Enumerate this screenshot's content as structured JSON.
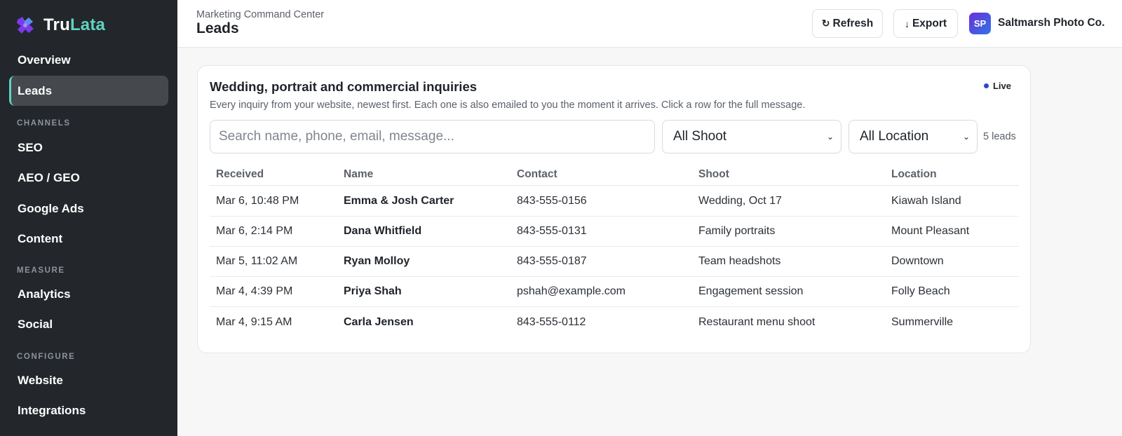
{
  "brand": {
    "name_part1": "Tru",
    "name_part2": "Lata",
    "accent_color": "#5fd3c0",
    "logo_icon": "puzzle-logo-icon"
  },
  "sidebar": {
    "items": [
      {
        "label": "Overview"
      },
      {
        "label": "Leads",
        "active": true
      },
      {
        "label": "SEO"
      },
      {
        "label": "AEO / GEO"
      },
      {
        "label": "Google Ads"
      },
      {
        "label": "Content"
      },
      {
        "label": "Analytics"
      },
      {
        "label": "Social"
      },
      {
        "label": "Website"
      },
      {
        "label": "Integrations"
      }
    ],
    "sections": {
      "channels": "CHANNELS",
      "measure": "MEASURE",
      "configure": "CONFIGURE"
    }
  },
  "header": {
    "breadcrumb": "Marketing Command Center",
    "title": "Leads",
    "refresh_label": "Refresh",
    "refresh_icon": "refresh-icon",
    "export_label": "Export",
    "export_icon": "arrow-down-icon",
    "avatar_initials": "SP",
    "org_name": "Saltmarsh Photo Co."
  },
  "card": {
    "title": "Wedding, portrait and commercial inquiries",
    "description": "Every inquiry from your website, newest first. Each one is also emailed to you the moment it arrives. Click a row for the full message.",
    "live_label": "Live",
    "live_color": "#3446c8"
  },
  "filters": {
    "search_placeholder": "Search name, phone, email, message...",
    "shoot_selected": "All Shoot",
    "location_selected": "All Location",
    "count_label": "5 leads"
  },
  "table": {
    "headers": [
      "Received",
      "Name",
      "Contact",
      "Shoot",
      "Location"
    ],
    "rows": [
      [
        "Mar 6, 10:48 PM",
        "Emma & Josh Carter",
        "843-555-0156",
        "Wedding, Oct 17",
        "Kiawah Island"
      ],
      [
        "Mar 6, 2:14 PM",
        "Dana Whitfield",
        "843-555-0131",
        "Family portraits",
        "Mount Pleasant"
      ],
      [
        "Mar 5, 11:02 AM",
        "Ryan Molloy",
        "843-555-0187",
        "Team headshots",
        "Downtown"
      ],
      [
        "Mar 4, 4:39 PM",
        "Priya Shah",
        "pshah@example.com",
        "Engagement session",
        "Folly Beach"
      ],
      [
        "Mar 4, 9:15 AM",
        "Carla Jensen",
        "843-555-0112",
        "Restaurant menu shoot",
        "Summerville"
      ]
    ]
  }
}
